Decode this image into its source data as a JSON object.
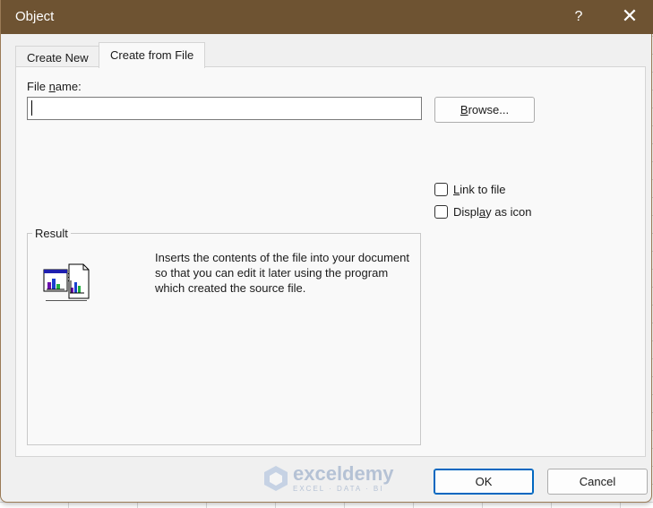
{
  "dialog": {
    "title": "Object",
    "help_glyph": "?",
    "close_glyph": "✕"
  },
  "tabs": [
    {
      "label": "Create New",
      "active": false
    },
    {
      "label": "Create from File",
      "active": true
    }
  ],
  "file": {
    "label_pre": "File ",
    "label_accel": "n",
    "label_post": "ame:",
    "value": "",
    "placeholder": ""
  },
  "browse": {
    "accel": "B",
    "rest": "rowse..."
  },
  "options": {
    "link": {
      "accel": "L",
      "rest": "ink to file",
      "checked": false
    },
    "display": {
      "pre": "Displ",
      "accel": "a",
      "post": "y as icon",
      "checked": false
    }
  },
  "result": {
    "legend": "Result",
    "icon": "embedded-chart-document-icon",
    "text": "Inserts the contents of the file into your document so that you can edit it later using the program which created the source file."
  },
  "buttons": {
    "ok": "OK",
    "cancel": "Cancel"
  },
  "watermark": {
    "name": "exceldemy",
    "tagline": "EXCEL · DATA · BI"
  },
  "colors": {
    "titlebar": "#6e5332",
    "accent": "#0067c0",
    "dialog_bg": "#f0f0f0"
  }
}
